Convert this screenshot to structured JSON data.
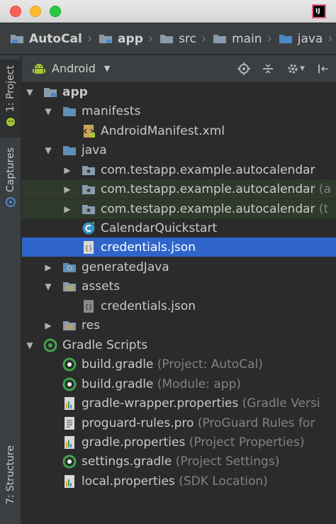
{
  "window": {
    "ide_logo_text": "IJ"
  },
  "breadcrumb": {
    "items": [
      "AutoCal",
      "app",
      "src",
      "main",
      "java"
    ]
  },
  "tool_strip": {
    "project_tab": "1: Project",
    "captures_tab": "Captures",
    "structure_tab": "7: Structure"
  },
  "panel": {
    "view_mode": "Android"
  },
  "tree": {
    "app": "app",
    "manifests": "manifests",
    "android_manifest": "AndroidManifest.xml",
    "java": "java",
    "pkg1": "com.testapp.example.autocalendar",
    "pkg2": "com.testapp.example.autocalendar",
    "pkg2_hint": "(a",
    "pkg3": "com.testapp.example.autocalendar",
    "pkg3_hint": "(t",
    "calendar_quickstart": "CalendarQuickstart",
    "credentials_java": "credentials.json",
    "generated_java": "generatedJava",
    "assets": "assets",
    "credentials_assets": "credentials.json",
    "res": "res",
    "gradle_scripts": "Gradle Scripts",
    "build_gradle_project": "build.gradle",
    "build_gradle_project_hint": "(Project: AutoCal)",
    "build_gradle_module": "build.gradle",
    "build_gradle_module_hint": "(Module: app)",
    "gradle_wrapper": "gradle-wrapper.properties",
    "gradle_wrapper_hint": "(Gradle Versi",
    "proguard": "proguard-rules.pro",
    "proguard_hint": "(ProGuard Rules for",
    "gradle_properties": "gradle.properties",
    "gradle_properties_hint": "(Project Properties)",
    "settings_gradle": "settings.gradle",
    "settings_gradle_hint": "(Project Settings)",
    "local_properties": "local.properties",
    "local_properties_hint": "(SDK Location)"
  },
  "colors": {
    "selection": "#2f65ca",
    "folder_blue": "#5e8fb8",
    "gradle_green": "#3fa34d",
    "android_green": "#a4c639"
  }
}
